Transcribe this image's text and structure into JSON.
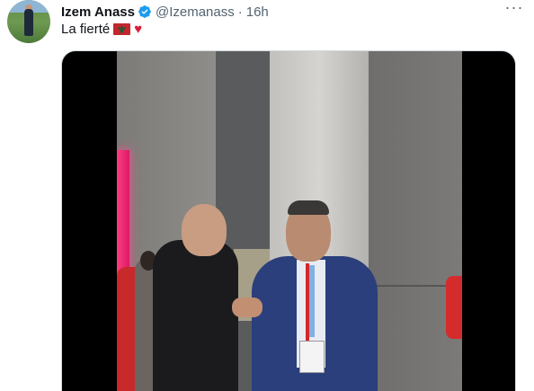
{
  "tweet": {
    "author_name": "Izem Anass",
    "handle": "@Izemanass",
    "separator": "·",
    "time": "16h",
    "text": "La fierté",
    "emoji_flag": "morocco-flag-icon",
    "emoji_heart": "♥",
    "more_label": "···"
  },
  "colors": {
    "verified_blue": "#1d9bf0",
    "secondary_text": "#536471",
    "heart_red": "#d91e38",
    "flag_red": "#c1272d",
    "flag_star_green": "#006233"
  }
}
